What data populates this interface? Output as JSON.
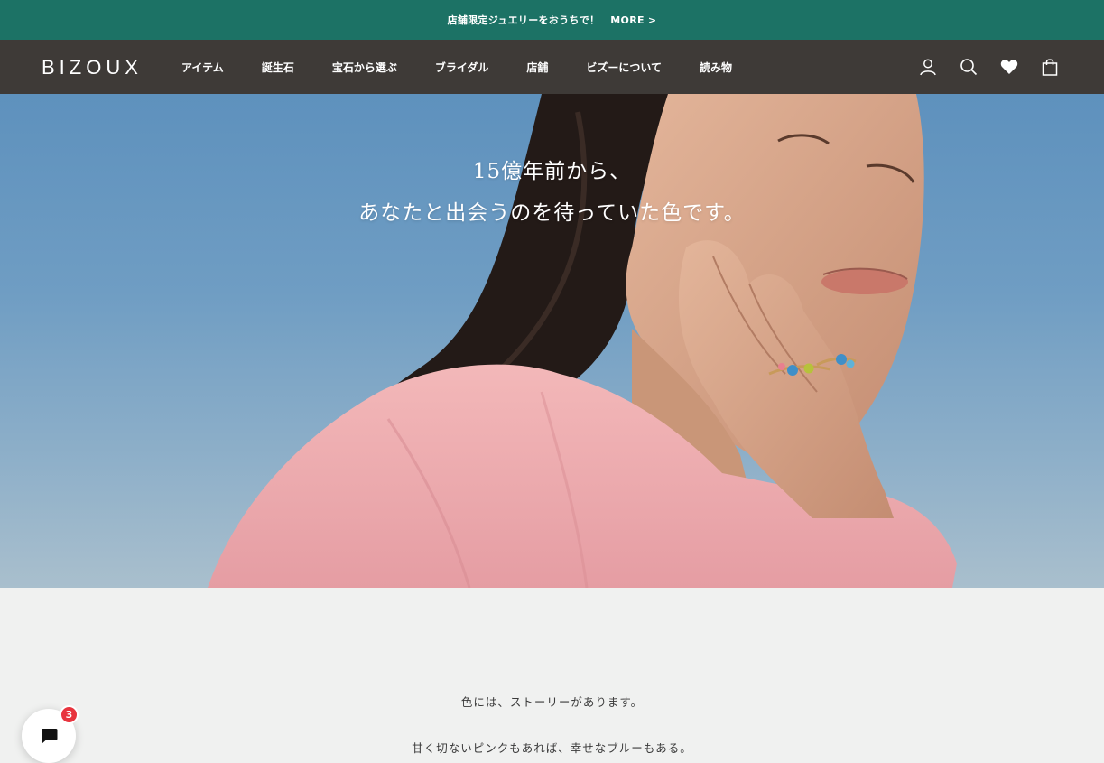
{
  "announcement": {
    "text": "店舗限定ジュエリーをおうちで！",
    "more_label": "MORE >"
  },
  "header": {
    "logo": "BIZOUX",
    "nav": [
      "アイテム",
      "誕生石",
      "宝石から選ぶ",
      "ブライダル",
      "店舗",
      "ビズーについて",
      "読み物"
    ],
    "icons": [
      "account-icon",
      "search-icon",
      "heart-icon",
      "bag-icon"
    ]
  },
  "hero": {
    "line1": "15億年前から、",
    "line2": "あなたと出会うのを待っていた色です。"
  },
  "story": {
    "line1": "色には、ストーリーがあります。",
    "line2": "甘く切ないピンクもあれば、幸せなブルーもある。"
  },
  "chat": {
    "badge_count": "3"
  },
  "colors": {
    "announcement_bg": "#1c7265",
    "header_bg": "#3e3a37",
    "badge": "#e8343e"
  }
}
